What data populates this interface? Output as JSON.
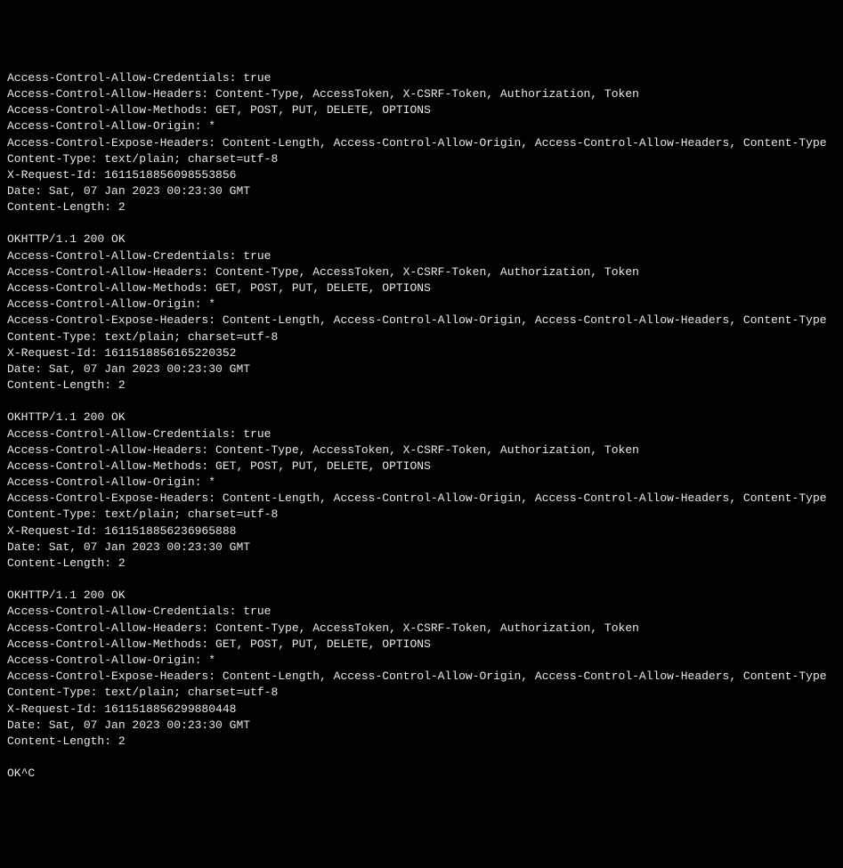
{
  "blocks": [
    {
      "headers": [
        "Access-Control-Allow-Credentials: true",
        "Access-Control-Allow-Headers: Content-Type, AccessToken, X-CSRF-Token, Authorization, Token",
        "Access-Control-Allow-Methods: GET, POST, PUT, DELETE, OPTIONS",
        "Access-Control-Allow-Origin: *",
        "Access-Control-Expose-Headers: Content-Length, Access-Control-Allow-Origin, Access-Control-Allow-Headers, Content-Type",
        "Content-Type: text/plain; charset=utf-8",
        "X-Request-Id: 1611518856098553856",
        "Date: Sat, 07 Jan 2023 00:23:30 GMT",
        "Content-Length: 2"
      ]
    },
    {
      "status": "OKHTTP/1.1 200 OK",
      "headers": [
        "Access-Control-Allow-Credentials: true",
        "Access-Control-Allow-Headers: Content-Type, AccessToken, X-CSRF-Token, Authorization, Token",
        "Access-Control-Allow-Methods: GET, POST, PUT, DELETE, OPTIONS",
        "Access-Control-Allow-Origin: *",
        "Access-Control-Expose-Headers: Content-Length, Access-Control-Allow-Origin, Access-Control-Allow-Headers, Content-Type",
        "Content-Type: text/plain; charset=utf-8",
        "X-Request-Id: 1611518856165220352",
        "Date: Sat, 07 Jan 2023 00:23:30 GMT",
        "Content-Length: 2"
      ]
    },
    {
      "status": "OKHTTP/1.1 200 OK",
      "headers": [
        "Access-Control-Allow-Credentials: true",
        "Access-Control-Allow-Headers: Content-Type, AccessToken, X-CSRF-Token, Authorization, Token",
        "Access-Control-Allow-Methods: GET, POST, PUT, DELETE, OPTIONS",
        "Access-Control-Allow-Origin: *",
        "Access-Control-Expose-Headers: Content-Length, Access-Control-Allow-Origin, Access-Control-Allow-Headers, Content-Type",
        "Content-Type: text/plain; charset=utf-8",
        "X-Request-Id: 1611518856236965888",
        "Date: Sat, 07 Jan 2023 00:23:30 GMT",
        "Content-Length: 2"
      ]
    },
    {
      "status": "OKHTTP/1.1 200 OK",
      "headers": [
        "Access-Control-Allow-Credentials: true",
        "Access-Control-Allow-Headers: Content-Type, AccessToken, X-CSRF-Token, Authorization, Token",
        "Access-Control-Allow-Methods: GET, POST, PUT, DELETE, OPTIONS",
        "Access-Control-Allow-Origin: *",
        "Access-Control-Expose-Headers: Content-Length, Access-Control-Allow-Origin, Access-Control-Allow-Headers, Content-Type",
        "Content-Type: text/plain; charset=utf-8",
        "X-Request-Id: 1611518856299880448",
        "Date: Sat, 07 Jan 2023 00:23:30 GMT",
        "Content-Length: 2"
      ]
    }
  ],
  "trailing": "OK^C"
}
